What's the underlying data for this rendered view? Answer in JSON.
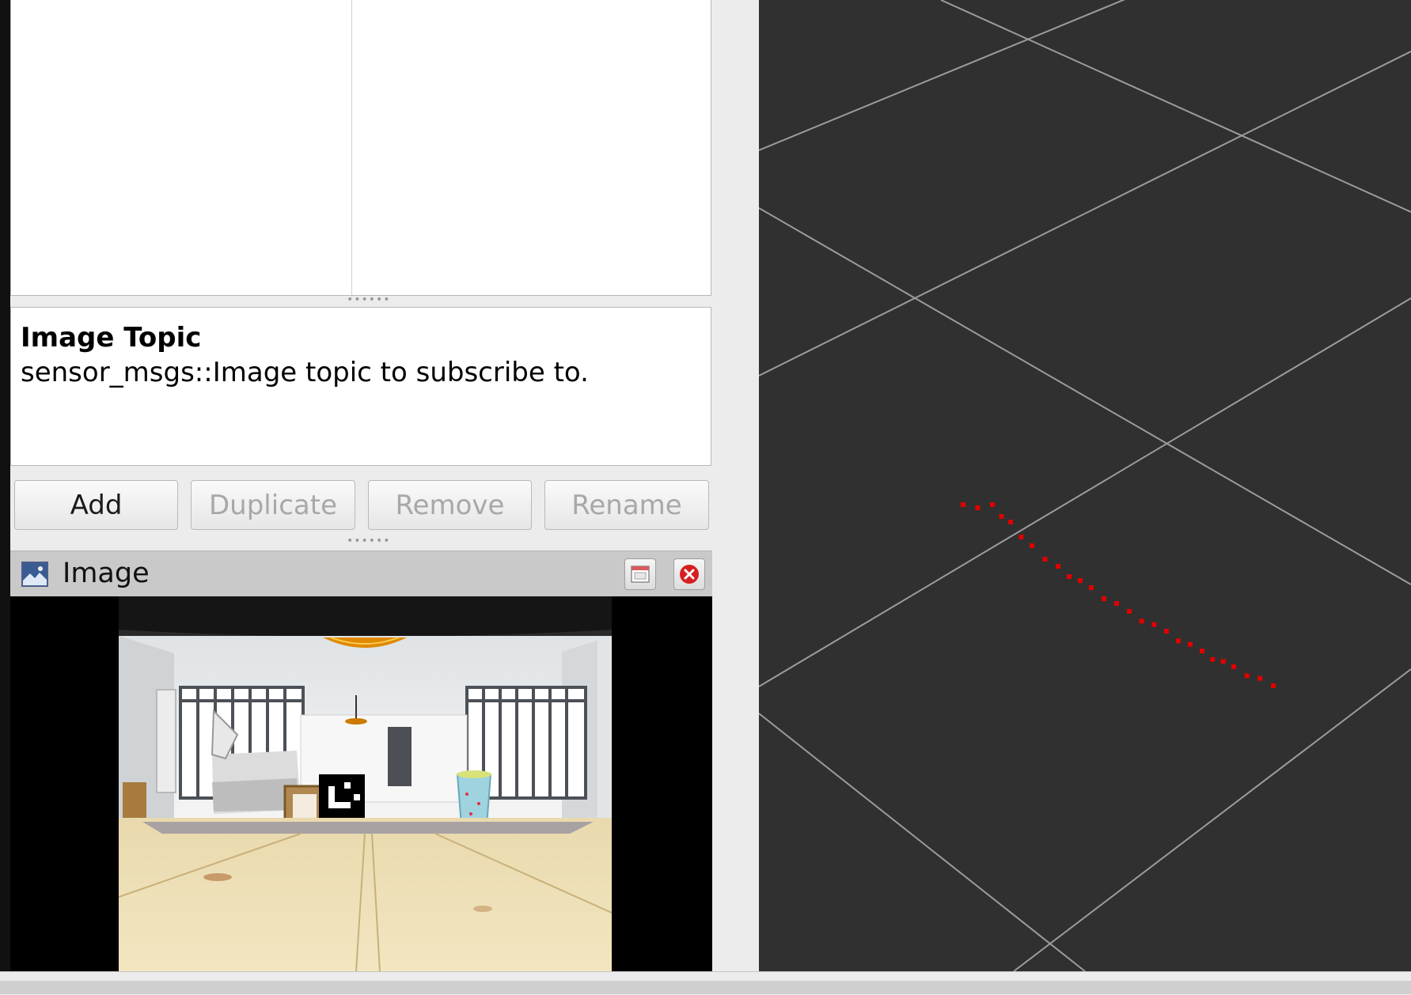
{
  "help": {
    "title": "Image Topic",
    "description": "sensor_msgs::Image topic to subscribe to."
  },
  "buttons": {
    "add": "Add",
    "duplicate": "Duplicate",
    "remove": "Remove",
    "rename": "Rename"
  },
  "image_panel": {
    "title": "Image",
    "icon": "image-icon"
  },
  "icons": {
    "undock": "undock-icon",
    "close": "close-icon"
  },
  "colors": {
    "viewport_background": "#303030",
    "grid_line": "#a0a0a0",
    "point_marker": "#e10000",
    "close_button": "#d61f1f"
  }
}
